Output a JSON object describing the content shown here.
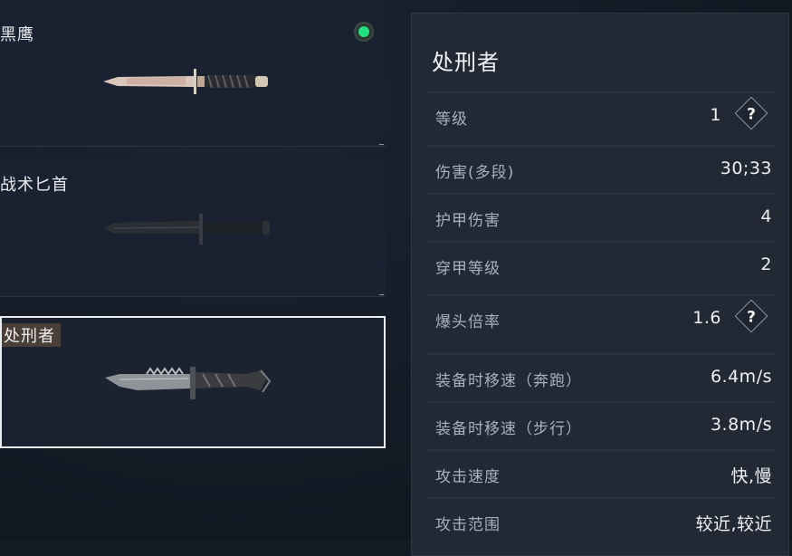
{
  "weapons": [
    {
      "name": "黑鹰",
      "status": "active"
    },
    {
      "name": "战术匕首"
    },
    {
      "name": "处刑者",
      "selected": true
    }
  ],
  "detail": {
    "title": "处刑者",
    "stats": [
      {
        "label": "等级",
        "value": "1",
        "help": "?"
      },
      {
        "label": "伤害(多段)",
        "value": "30;33"
      },
      {
        "label": "护甲伤害",
        "value": "4"
      },
      {
        "label": "穿甲等级",
        "value": "2"
      },
      {
        "label": "爆头倍率",
        "value": "1.6",
        "help": "?"
      },
      {
        "label": "装备时移速（奔跑）",
        "value": "6.4m/s"
      },
      {
        "label": "装备时移速（步行）",
        "value": "3.8m/s"
      },
      {
        "label": "攻击速度",
        "value": "快,慢"
      },
      {
        "label": "攻击范围",
        "value": "较近,较近"
      }
    ]
  },
  "colors": {
    "status_dot": "#23e07f",
    "background": "#151b25",
    "panel": "#222935"
  }
}
